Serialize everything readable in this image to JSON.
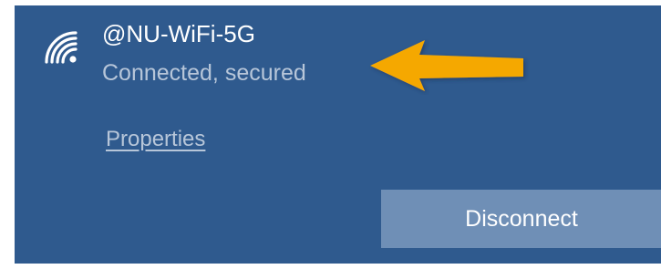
{
  "network": {
    "name": "@NU-WiFi-5G",
    "status": "Connected, secured",
    "icon": "wifi-signal-icon"
  },
  "actions": {
    "properties_label": "Properties",
    "disconnect_label": "Disconnect"
  },
  "annotation": {
    "icon": "arrow-left-icon",
    "color": "#f5a800"
  },
  "colors": {
    "panel_bg": "#2f5a8e",
    "button_bg": "#6f8fb6",
    "secondary_text": "#b7c6d9",
    "primary_text": "#ffffff"
  }
}
